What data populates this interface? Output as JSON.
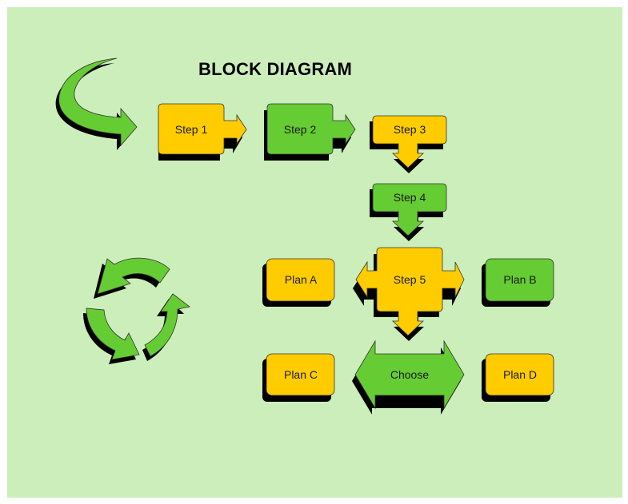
{
  "title": "BLOCK DIAGRAM",
  "colors": {
    "background": "#cceebb",
    "yellow": "#ffcc00",
    "green": "#66cc33",
    "shadow": "#000000",
    "outline": "#333333"
  },
  "nodes": {
    "step1": {
      "label": "Step 1",
      "color": "yellow",
      "connector": "arrow-right"
    },
    "step2": {
      "label": "Step 2",
      "color": "green",
      "connector": "arrow-right"
    },
    "step3": {
      "label": "Step 3",
      "color": "yellow",
      "connector": "arrow-down"
    },
    "step4": {
      "label": "Step 4",
      "color": "green",
      "connector": "arrow-down"
    },
    "step5": {
      "label": "Step 5",
      "color": "yellow",
      "connector": "arrow-left-right-down"
    },
    "plan_a": {
      "label": "Plan A",
      "color": "yellow"
    },
    "plan_b": {
      "label": "Plan B",
      "color": "green"
    },
    "plan_c": {
      "label": "Plan C",
      "color": "yellow"
    },
    "plan_d": {
      "label": "Plan D",
      "color": "yellow"
    },
    "choose": {
      "label": "Choose",
      "color": "green",
      "shape": "double-arrow"
    }
  },
  "decorations": {
    "curved_arrow": {
      "icon": "curved-arrow-icon",
      "color": "green"
    },
    "cycle_arrows": {
      "icon": "recycle-arrows-icon",
      "color": "green"
    }
  },
  "flow": [
    {
      "from": "Step 1",
      "to": "Step 2"
    },
    {
      "from": "Step 2",
      "to": "Step 3"
    },
    {
      "from": "Step 3",
      "to": "Step 4"
    },
    {
      "from": "Step 4",
      "to": "Step 5"
    },
    {
      "from": "Step 5",
      "to": "Plan A"
    },
    {
      "from": "Step 5",
      "to": "Plan B"
    },
    {
      "from": "Step 5",
      "to": "Choose"
    }
  ]
}
